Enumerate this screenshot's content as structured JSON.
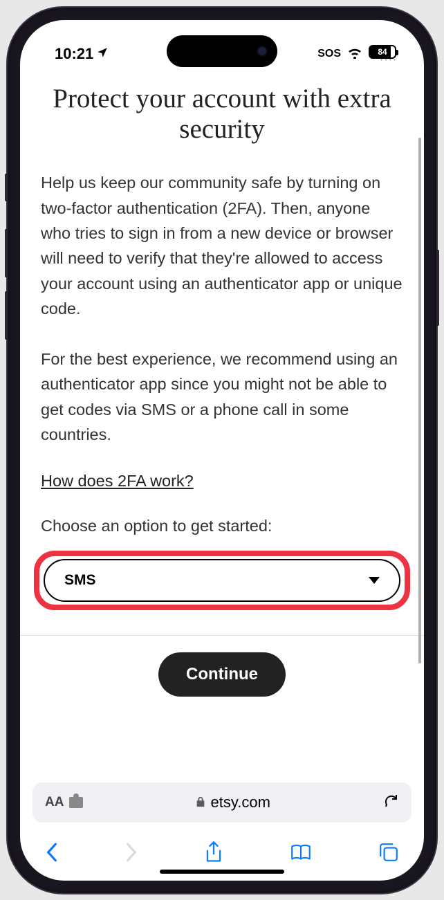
{
  "status": {
    "time": "10:21",
    "sos": "SOS",
    "battery": "84"
  },
  "page": {
    "title": "Protect your account with extra security",
    "para1": "Help us keep our community safe by turning on two-factor authentication (2FA). Then, anyone who tries to sign in from a new device or browser will need to verify that they're allowed to access your account using an authenticator app or unique code.",
    "para2": "For the best experience, we recommend using an authenticator app since you might not be able to get codes via SMS or a phone call in some countries.",
    "link": "How does 2FA work?",
    "choose_label": "Choose an option to get started:",
    "dropdown_value": "SMS",
    "continue": "Continue"
  },
  "safari": {
    "aa": "AA",
    "domain": "etsy.com"
  },
  "icons": {
    "location": "location-arrow",
    "wifi": "wifi",
    "lock": "lock",
    "reload": "reload",
    "back": "chevron-left",
    "forward": "chevron-right",
    "share": "square-arrow-up",
    "bookmarks": "open-book",
    "tabs": "stacked-squares"
  }
}
